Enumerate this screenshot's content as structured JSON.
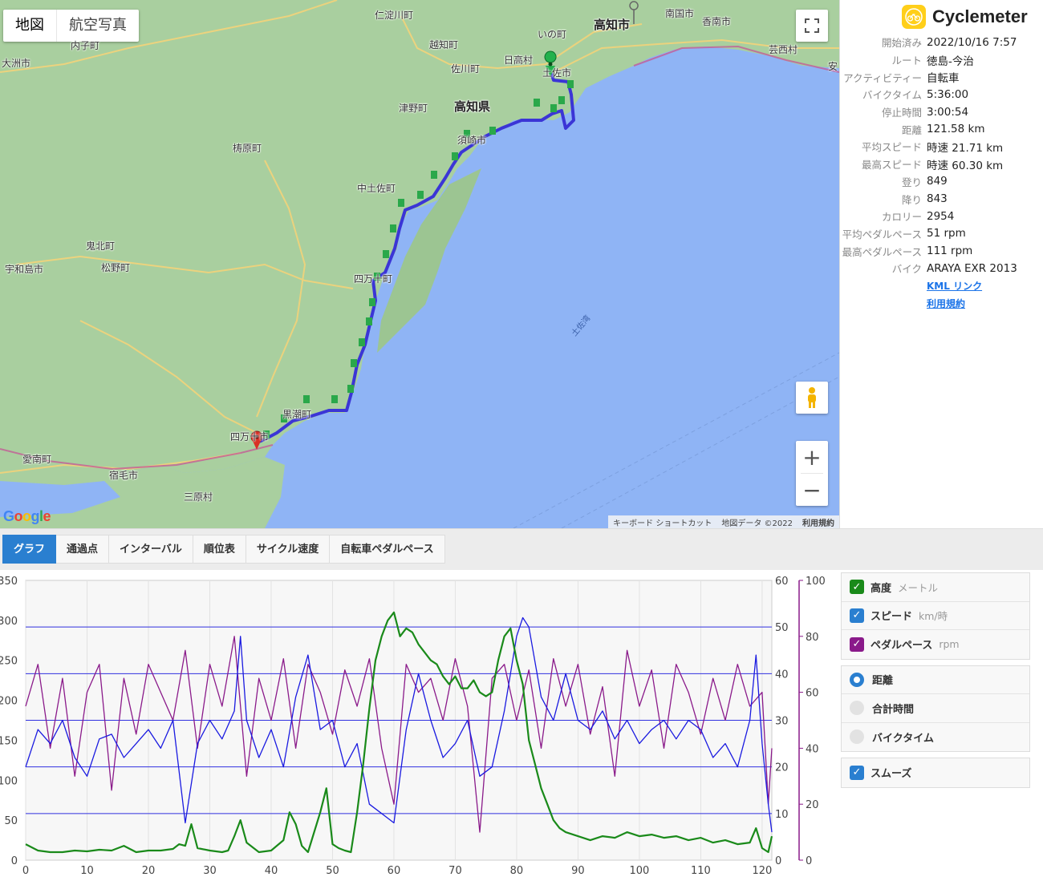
{
  "map": {
    "type_buttons": [
      "地図",
      "航空写真"
    ],
    "places": [
      {
        "name": "高知市",
        "cls": "big"
      },
      {
        "name": "南国市"
      },
      {
        "name": "香南市"
      },
      {
        "name": "芸西村"
      },
      {
        "name": "安"
      },
      {
        "name": "仁淀川町"
      },
      {
        "name": "いの町"
      },
      {
        "name": "越知町"
      },
      {
        "name": "日高村"
      },
      {
        "name": "佐川町"
      },
      {
        "name": "土佐市"
      },
      {
        "name": "高知県",
        "cls": "big"
      },
      {
        "name": "津野町"
      },
      {
        "name": "梼原町"
      },
      {
        "name": "須崎市"
      },
      {
        "name": "中土佐町"
      },
      {
        "name": "四万十町"
      },
      {
        "name": "鬼北町"
      },
      {
        "name": "松野町"
      },
      {
        "name": "宇和島市"
      },
      {
        "name": "大洲市"
      },
      {
        "name": "内子町"
      },
      {
        "name": "黒潮町"
      },
      {
        "name": "四万十市"
      },
      {
        "name": "愛南町"
      },
      {
        "name": "宿毛市"
      },
      {
        "name": "三原村"
      },
      {
        "name": "土佐湾",
        "cls": "sea"
      }
    ],
    "google": "Google",
    "attribution": [
      "キーボード ショートカット",
      "地図データ ©2022",
      "利用規約"
    ],
    "colors": {
      "land": "#a9cf9f",
      "water": "#8fb4f5",
      "route": "#3b35d6",
      "start": "#22b14c",
      "end": "#d93025"
    }
  },
  "panel": {
    "app_name": "Cyclemeter",
    "stats": [
      {
        "label": "開始済み",
        "value": "2022/10/16 7:57"
      },
      {
        "label": "ルート",
        "value": "徳島-今治"
      },
      {
        "label": "アクティビティー",
        "value": "自転車"
      },
      {
        "label": "バイクタイム",
        "value": "5:36:00"
      },
      {
        "label": "停止時間",
        "value": "3:00:54"
      },
      {
        "label": "距離",
        "value": "121.58 km"
      },
      {
        "label": "平均スピード",
        "value": "時速 21.71 km"
      },
      {
        "label": "最高スピード",
        "value": "時速 60.30 km"
      },
      {
        "label": "登り",
        "value": "849"
      },
      {
        "label": "降り",
        "value": "843"
      },
      {
        "label": "カロリー",
        "value": "2954"
      },
      {
        "label": "平均ペダルペース",
        "value": "51 rpm"
      },
      {
        "label": "最高ペダルペース",
        "value": "111 rpm"
      },
      {
        "label": "バイク",
        "value": "ARAYA EXR 2013"
      }
    ],
    "links": [
      "KML リンク",
      "利用規約"
    ]
  },
  "tabs": {
    "items": [
      "グラフ",
      "通過点",
      "インターバル",
      "順位表",
      "サイクル速度",
      "自転車ペダルペース"
    ],
    "active": 0
  },
  "options": {
    "series": [
      {
        "label": "高度",
        "unit": "メートル",
        "color": "#1a8a1a",
        "checked": true
      },
      {
        "label": "スピード",
        "unit": "km/時",
        "color": "#2a7fd0",
        "checked": true
      },
      {
        "label": "ペダルペース",
        "unit": "rpm",
        "color": "#8a1a8a",
        "checked": true
      }
    ],
    "x_modes": [
      {
        "label": "距離",
        "selected": true
      },
      {
        "label": "合計時間",
        "selected": false
      },
      {
        "label": "バイクタイム",
        "selected": false
      }
    ],
    "smooth": {
      "label": "スムーズ",
      "checked": true
    }
  },
  "chart_data": {
    "type": "line",
    "x_ticks": [
      0,
      10,
      20,
      30,
      40,
      50,
      60,
      70,
      80,
      90,
      100,
      110,
      120
    ],
    "xlim": [
      0,
      121.58
    ],
    "left_axis": {
      "ticks": [
        0,
        50,
        100,
        150,
        200,
        250,
        300,
        350
      ],
      "labels": [
        "0",
        "50",
        "100",
        "150",
        "200",
        "250",
        "300",
        "350"
      ],
      "ylim": [
        0,
        350
      ]
    },
    "right_axis_1": {
      "ticks": [
        0,
        10,
        20,
        30,
        40,
        50,
        60
      ],
      "ylim": [
        0,
        60
      ]
    },
    "right_axis_2": {
      "ticks": [
        0,
        20,
        40,
        60,
        80,
        100
      ],
      "ylim": [
        0,
        100
      ]
    },
    "series": [
      {
        "name": "高度",
        "axis": "left",
        "color": "#1a8a1a",
        "x": [
          0,
          2,
          4,
          6,
          8,
          10,
          12,
          14,
          16,
          18,
          20,
          22,
          24,
          25,
          26,
          27,
          28,
          30,
          32,
          33,
          34,
          35,
          36,
          38,
          40,
          42,
          43,
          44,
          45,
          46,
          48,
          49,
          50,
          51,
          52,
          53,
          54,
          55,
          56,
          57,
          58,
          59,
          60,
          61,
          62,
          63,
          64,
          65,
          66,
          67,
          68,
          69,
          70,
          71,
          72,
          73,
          74,
          75,
          76,
          77,
          78,
          79,
          80,
          81,
          82,
          83,
          84,
          85,
          86,
          87,
          88,
          90,
          92,
          94,
          96,
          98,
          100,
          102,
          104,
          106,
          108,
          110,
          112,
          114,
          116,
          118,
          119,
          120,
          121,
          121.58
        ],
        "y": [
          20,
          12,
          10,
          10,
          12,
          11,
          13,
          12,
          18,
          10,
          12,
          12,
          14,
          20,
          18,
          45,
          15,
          12,
          10,
          12,
          30,
          50,
          22,
          10,
          12,
          25,
          60,
          45,
          18,
          10,
          60,
          90,
          20,
          15,
          12,
          10,
          60,
          120,
          190,
          250,
          280,
          300,
          310,
          280,
          290,
          285,
          270,
          260,
          250,
          245,
          230,
          220,
          230,
          215,
          215,
          225,
          210,
          205,
          210,
          250,
          280,
          290,
          250,
          220,
          150,
          120,
          90,
          70,
          50,
          40,
          35,
          30,
          25,
          30,
          28,
          35,
          30,
          32,
          28,
          30,
          25,
          28,
          22,
          25,
          20,
          22,
          40,
          15,
          10,
          30
        ]
      },
      {
        "name": "スピード",
        "axis": "right_1",
        "color": "#1a1ae0",
        "x": [
          0,
          2,
          4,
          6,
          8,
          10,
          12,
          14,
          16,
          18,
          20,
          22,
          24,
          26,
          28,
          30,
          32,
          34,
          35,
          36,
          38,
          40,
          42,
          44,
          46,
          48,
          50,
          52,
          54,
          56,
          58,
          60,
          62,
          64,
          66,
          68,
          70,
          72,
          74,
          76,
          78,
          80,
          81,
          82,
          84,
          86,
          88,
          90,
          92,
          94,
          96,
          98,
          100,
          102,
          104,
          106,
          108,
          110,
          112,
          114,
          116,
          118,
          119,
          120,
          121,
          121.58
        ],
        "y": [
          20,
          28,
          25,
          30,
          22,
          18,
          26,
          27,
          22,
          25,
          28,
          24,
          30,
          8,
          25,
          30,
          26,
          32,
          48,
          30,
          22,
          28,
          20,
          35,
          44,
          28,
          30,
          20,
          25,
          12,
          10,
          8,
          28,
          40,
          30,
          22,
          25,
          30,
          18,
          20,
          32,
          48,
          52,
          50,
          35,
          30,
          40,
          30,
          28,
          32,
          26,
          30,
          25,
          28,
          30,
          26,
          30,
          28,
          22,
          25,
          20,
          30,
          44,
          25,
          12,
          6
        ]
      },
      {
        "name": "ペダルペース",
        "axis": "right_2",
        "color": "#8a1a8a",
        "x": [
          0,
          2,
          4,
          6,
          8,
          10,
          12,
          14,
          16,
          18,
          20,
          22,
          24,
          26,
          28,
          30,
          32,
          34,
          36,
          38,
          40,
          42,
          44,
          46,
          48,
          50,
          52,
          54,
          56,
          58,
          60,
          62,
          64,
          66,
          68,
          70,
          72,
          74,
          76,
          78,
          80,
          82,
          84,
          86,
          88,
          90,
          92,
          94,
          96,
          98,
          100,
          102,
          104,
          106,
          108,
          110,
          112,
          114,
          116,
          118,
          120,
          121,
          121.58
        ],
        "y": [
          55,
          70,
          40,
          65,
          30,
          60,
          70,
          25,
          65,
          45,
          70,
          60,
          50,
          75,
          40,
          70,
          55,
          80,
          30,
          65,
          50,
          72,
          40,
          70,
          60,
          45,
          68,
          55,
          72,
          40,
          20,
          70,
          60,
          65,
          50,
          72,
          55,
          10,
          65,
          70,
          50,
          68,
          40,
          72,
          55,
          70,
          45,
          62,
          30,
          75,
          55,
          68,
          40,
          70,
          60,
          45,
          65,
          50,
          70,
          55,
          60,
          20,
          40
        ]
      }
    ],
    "horizontal_lines_right_1": [
      10,
      20,
      30,
      40,
      50
    ]
  }
}
